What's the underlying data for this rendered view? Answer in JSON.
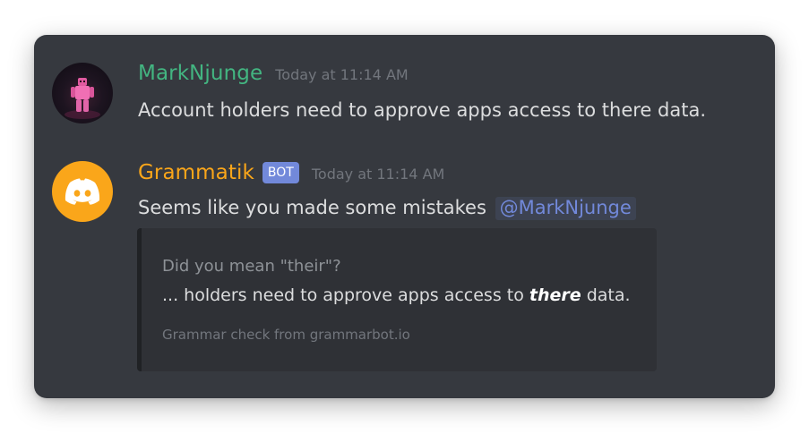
{
  "messages": [
    {
      "author": "MarkNjunge",
      "author_color": "#43b581",
      "timestamp": "Today at 11:14 AM",
      "content": "Account holders need to approve apps access to there data.",
      "avatar_icon": "user-avatar-figure"
    },
    {
      "author": "Grammatik",
      "author_color": "#faa61a",
      "bot_tag": "BOT",
      "timestamp": "Today at 11:14 AM",
      "content": "Seems like you made some mistakes",
      "mention": "@MarkNjunge",
      "avatar_icon": "discord-logo-icon",
      "embed": {
        "title": "Did you mean \"their\"?",
        "description_prefix": "... holders need to approve apps access to",
        "description_highlight": "there",
        "description_suffix": "data.",
        "footer": "Grammar check from grammarbot.io"
      }
    }
  ],
  "colors": {
    "background": "#36393f",
    "embed_background": "#2f3136",
    "embed_border": "#202225",
    "text": "#dcddde",
    "muted": "#72767d",
    "bot_tag": "#7289da",
    "mention": "#7289da",
    "bot_avatar": "#faa61a"
  }
}
